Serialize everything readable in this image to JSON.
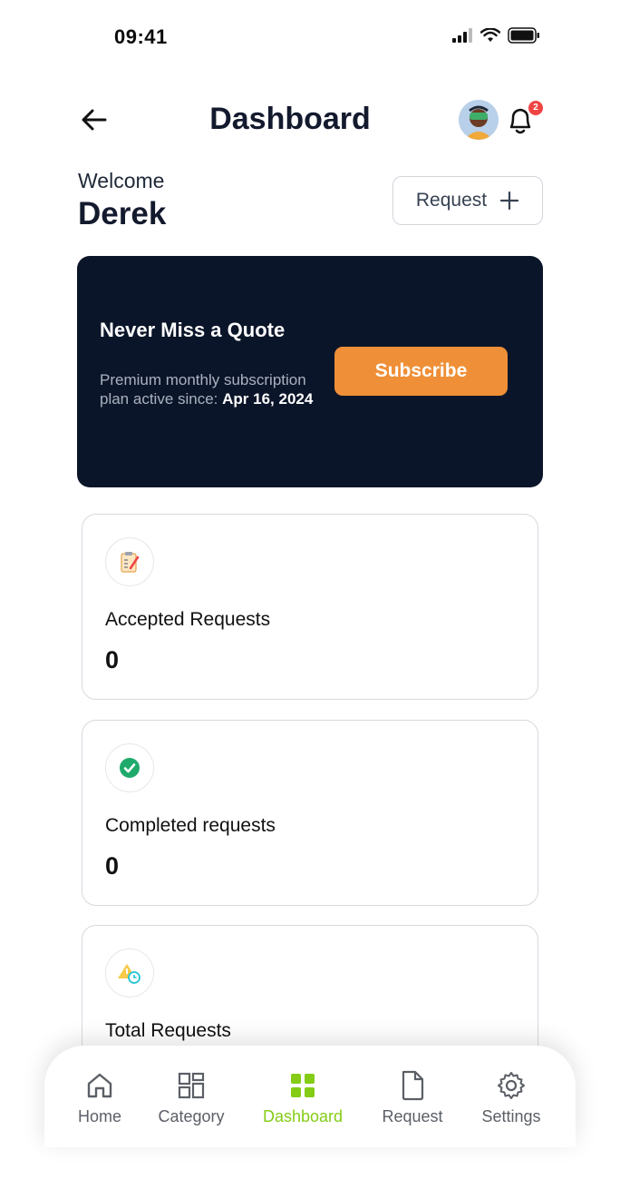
{
  "status_bar": {
    "time": "09:41"
  },
  "header": {
    "title": "Dashboard",
    "notification_count": "2"
  },
  "welcome": {
    "greeting": "Welcome",
    "name": "Derek"
  },
  "request_button": {
    "label": "Request"
  },
  "promo": {
    "title": "Never Miss a Quote",
    "description": "Premium monthly subscription plan active since: ",
    "since_date": "Apr 16, 2024",
    "button_label": "Subscribe"
  },
  "stats": [
    {
      "label": "Accepted Requests",
      "value": "0",
      "icon": "clipboard-icon"
    },
    {
      "label": "Completed requests",
      "value": "0",
      "icon": "check-circle-icon"
    },
    {
      "label": "Total Requests",
      "icon": "clock-warning-icon"
    }
  ],
  "nav": {
    "items": [
      {
        "label": "Home",
        "icon": "home-icon"
      },
      {
        "label": "Category",
        "icon": "category-icon"
      },
      {
        "label": "Dashboard",
        "icon": "dashboard-icon"
      },
      {
        "label": "Request",
        "icon": "document-icon"
      },
      {
        "label": "Settings",
        "icon": "gear-icon"
      }
    ],
    "active": "Dashboard"
  },
  "colors": {
    "accent": "#84cc16",
    "promo_bg": "#0b1529",
    "subscribe": "#ef8f37",
    "badge": "#ef4444"
  }
}
